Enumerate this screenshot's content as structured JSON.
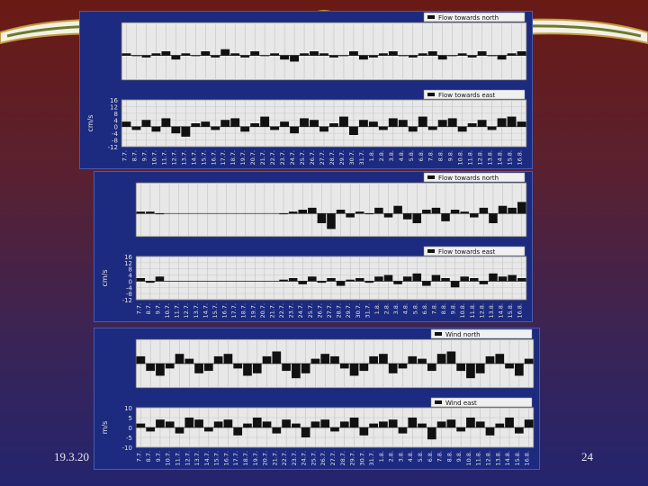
{
  "slide": {
    "date": "19.3.20",
    "page_number": "24"
  },
  "colors": {
    "background_top": "#6a1a14",
    "background_bottom": "#24246e",
    "panel": "#1c2a80",
    "plot_area": "#e8e8e8",
    "series": "#111111",
    "banner_gold": "#c49a3a"
  },
  "chart_data": [
    {
      "type": "area",
      "legend": "Flow towards north",
      "ylim": [
        -12,
        16
      ],
      "grid": true,
      "legend_position": "top-right",
      "x": [
        "7.7.",
        "8.7.",
        "9.7.",
        "10.7.",
        "11.7.",
        "12.7.",
        "13.7.",
        "14.7.",
        "15.7.",
        "16.7.",
        "17.7.",
        "18.7.",
        "19.7.",
        "20.7.",
        "21.7.",
        "22.7.",
        "23.7.",
        "24.7.",
        "25.7.",
        "26.7.",
        "27.7.",
        "28.7.",
        "29.7.",
        "30.7.",
        "31.7.",
        "1.8.",
        "2.8.",
        "3.8.",
        "4.8.",
        "5.8.",
        "6.8.",
        "7.8.",
        "8.8.",
        "9.8.",
        "10.8.",
        "11.8.",
        "12.8.",
        "13.8.",
        "14.8.",
        "15.8.",
        "16.8."
      ],
      "values": [
        1,
        0,
        -1,
        1,
        2,
        -2,
        1,
        0,
        2,
        -1,
        3,
        1,
        -1,
        2,
        0,
        1,
        -2,
        -3,
        1,
        2,
        1,
        -1,
        0,
        2,
        -2,
        -1,
        1,
        2,
        0,
        -1,
        1,
        2,
        -2,
        0,
        1,
        -1,
        2,
        0,
        -2,
        1,
        2
      ]
    },
    {
      "type": "area",
      "legend": "Flow towards east",
      "ylabel": "cm/s",
      "yticks": [
        16,
        12,
        8,
        4,
        0,
        -4,
        -8,
        -12
      ],
      "ylim": [
        -12,
        16
      ],
      "grid": true,
      "legend_position": "top-right",
      "x": [
        "7.7.",
        "8.7.",
        "9.7.",
        "10.7.",
        "11.7.",
        "12.7.",
        "13.7.",
        "14.7.",
        "15.7.",
        "16.7.",
        "17.7.",
        "18.7.",
        "19.7.",
        "20.7.",
        "21.7.",
        "22.7.",
        "23.7.",
        "24.7.",
        "25.7.",
        "26.7.",
        "27.7.",
        "28.7.",
        "29.7.",
        "30.7.",
        "31.7.",
        "1.8.",
        "2.8.",
        "3.8.",
        "4.8.",
        "5.8.",
        "6.8.",
        "7.8.",
        "8.8.",
        "9.8.",
        "10.8.",
        "11.8.",
        "12.8.",
        "13.8.",
        "14.8.",
        "15.8.",
        "16.8."
      ],
      "values": [
        3,
        -2,
        4,
        -3,
        5,
        -4,
        -6,
        2,
        3,
        -2,
        4,
        5,
        -3,
        2,
        6,
        -2,
        3,
        -4,
        5,
        4,
        -3,
        2,
        6,
        -5,
        4,
        3,
        -2,
        5,
        4,
        -3,
        6,
        -2,
        4,
        5,
        -3,
        2,
        4,
        -2,
        5,
        6,
        3
      ]
    },
    {
      "type": "area",
      "legend": "Flow towards north",
      "ylim": [
        -12,
        16
      ],
      "grid": true,
      "legend_position": "top-right",
      "x": [
        "7.7.",
        "8.7.",
        "9.7.",
        "10.7.",
        "11.7.",
        "12.7.",
        "13.7.",
        "14.7.",
        "15.7.",
        "16.7.",
        "17.7.",
        "18.7.",
        "19.7.",
        "20.7.",
        "21.7.",
        "22.7.",
        "23.7.",
        "24.7.",
        "25.7.",
        "26.7.",
        "27.7.",
        "28.7.",
        "29.7.",
        "30.7.",
        "31.7.",
        "1.8.",
        "2.8.",
        "3.8.",
        "4.8.",
        "5.8.",
        "6.8.",
        "7.8.",
        "8.8.",
        "9.8.",
        "10.8.",
        "11.8.",
        "12.8.",
        "13.8.",
        "14.8.",
        "15.8.",
        "16.8."
      ],
      "values": [
        1,
        1,
        0,
        null,
        null,
        null,
        null,
        null,
        null,
        null,
        null,
        null,
        null,
        null,
        null,
        0,
        1,
        2,
        3,
        -5,
        -8,
        2,
        -2,
        1,
        0,
        3,
        -2,
        4,
        -3,
        -5,
        2,
        3,
        -4,
        2,
        1,
        -2,
        3,
        -5,
        4,
        3,
        6
      ]
    },
    {
      "type": "area",
      "legend": "Flow towards east",
      "ylabel": "cm/s",
      "yticks": [
        16,
        12,
        8,
        4,
        0,
        -4,
        -8,
        -12
      ],
      "ylim": [
        -12,
        16
      ],
      "grid": true,
      "legend_position": "top-right",
      "x": [
        "7.7.",
        "8.7.",
        "9.7.",
        "10.7.",
        "11.7.",
        "12.7.",
        "13.7.",
        "14.7.",
        "15.7.",
        "16.7.",
        "17.7.",
        "18.7.",
        "19.7.",
        "20.7.",
        "21.7.",
        "22.7.",
        "23.7.",
        "24.7.",
        "25.7.",
        "26.7.",
        "27.7.",
        "28.7.",
        "29.7.",
        "30.7.",
        "31.7.",
        "1.8.",
        "2.8.",
        "3.8.",
        "4.8.",
        "5.8.",
        "6.8.",
        "7.8.",
        "8.8.",
        "9.8.",
        "10.8.",
        "11.8.",
        "12.8.",
        "13.8.",
        "14.8.",
        "15.8.",
        "16.8."
      ],
      "values": [
        2,
        -1,
        3,
        null,
        null,
        null,
        null,
        null,
        null,
        null,
        null,
        null,
        null,
        null,
        null,
        1,
        2,
        -2,
        3,
        -1,
        2,
        -3,
        1,
        2,
        -1,
        3,
        4,
        -2,
        3,
        5,
        -3,
        4,
        2,
        -4,
        3,
        2,
        -2,
        5,
        3,
        4,
        2
      ]
    },
    {
      "type": "area",
      "legend": "Wind north",
      "ylim": [
        -10,
        10
      ],
      "grid": true,
      "legend_position": "top-right",
      "x": [
        "7.7.",
        "8.7.",
        "9.7.",
        "10.7.",
        "11.7.",
        "12.7.",
        "13.7.",
        "14.7.",
        "15.7.",
        "16.7.",
        "17.7.",
        "18.7.",
        "19.7.",
        "20.7.",
        "21.7.",
        "22.7.",
        "23.7.",
        "24.7.",
        "25.7.",
        "26.7.",
        "27.7.",
        "28.7.",
        "29.7.",
        "30.7.",
        "31.7.",
        "1.8.",
        "2.8.",
        "3.8.",
        "4.8.",
        "5.8.",
        "6.8.",
        "7.8.",
        "8.8.",
        "9.8.",
        "10.8.",
        "11.8.",
        "12.8.",
        "13.8.",
        "14.8.",
        "15.8.",
        "16.8."
      ],
      "values": [
        3,
        -3,
        -5,
        -2,
        4,
        2,
        -4,
        -3,
        3,
        4,
        -2,
        -5,
        -4,
        3,
        5,
        -3,
        -6,
        -4,
        2,
        4,
        3,
        -2,
        -5,
        -3,
        3,
        4,
        -4,
        -2,
        3,
        2,
        -3,
        4,
        5,
        -3,
        -6,
        -4,
        3,
        4,
        -2,
        -5,
        2
      ]
    },
    {
      "type": "area",
      "legend": "Wind east",
      "ylabel": "m/s",
      "yticks": [
        10,
        5,
        0,
        -5,
        -10
      ],
      "ylim": [
        -10,
        10
      ],
      "grid": true,
      "legend_position": "top-right",
      "x": [
        "7.7.",
        "8.7.",
        "9.7.",
        "10.7.",
        "11.7.",
        "12.7.",
        "13.7.",
        "14.7.",
        "15.7.",
        "16.7.",
        "17.7.",
        "18.7.",
        "19.7.",
        "20.7.",
        "21.7.",
        "22.7.",
        "23.7.",
        "24.7.",
        "25.7.",
        "26.7.",
        "27.7.",
        "28.7.",
        "29.7.",
        "30.7.",
        "31.7.",
        "1.8.",
        "2.8.",
        "3.8.",
        "4.8.",
        "5.8.",
        "6.8.",
        "7.8.",
        "8.8.",
        "9.8.",
        "10.8.",
        "11.8.",
        "12.8.",
        "13.8.",
        "14.8.",
        "15.8.",
        "16.8."
      ],
      "values": [
        2,
        -2,
        4,
        3,
        -3,
        5,
        4,
        -2,
        3,
        4,
        -4,
        2,
        5,
        3,
        -3,
        4,
        2,
        -5,
        3,
        4,
        -2,
        3,
        5,
        -4,
        2,
        3,
        4,
        -3,
        5,
        2,
        -6,
        3,
        4,
        -2,
        5,
        3,
        -4,
        2,
        5,
        -3,
        4
      ]
    }
  ]
}
